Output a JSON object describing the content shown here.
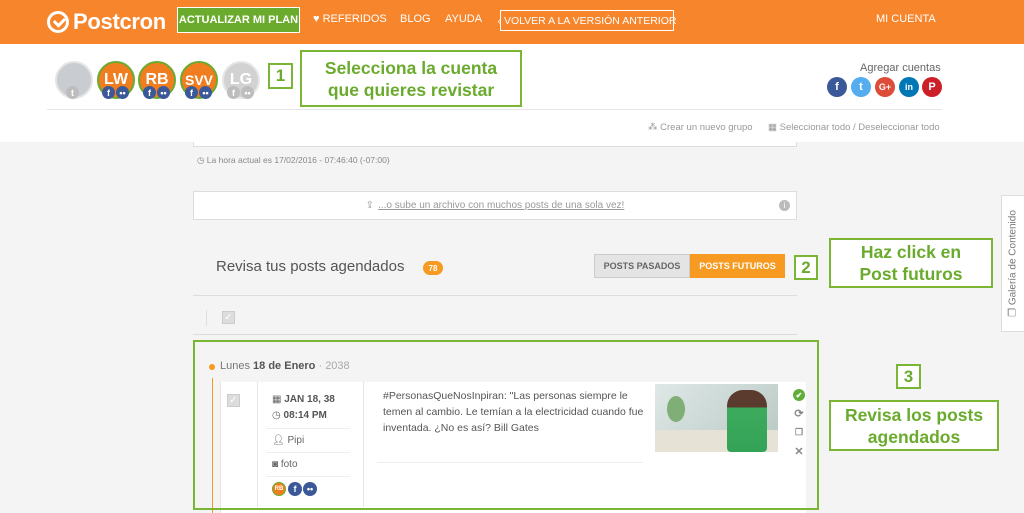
{
  "topnav": {
    "logo": "Postcron",
    "plan_button": "ACTUALIZAR MI PLAN",
    "referidos": "♥ REFERIDOS",
    "blog": "BLOG",
    "ayuda": "AYUDA",
    "volver": "‹ VOLVER A LA VERSIÓN ANTERIOR",
    "mi_cuenta": "MI CUENTA"
  },
  "accounts": {
    "items": [
      {
        "initials": "",
        "selected": false
      },
      {
        "initials": "LW",
        "selected": true
      },
      {
        "initials": "RB",
        "selected": true
      },
      {
        "initials": "SVV",
        "selected": true
      },
      {
        "initials": "LG",
        "selected": false
      }
    ],
    "agregar_label": "Agregar cuentas",
    "crear_grupo": "Crear un nuevo grupo",
    "seleccionar_todo": "Seleccionar todo / Deseleccionar todo"
  },
  "annotations": {
    "step1_num": "1",
    "step1_text_line1": "Selecciona la cuenta",
    "step1_text_line2": "que quieres revistar",
    "step2_num": "2",
    "step2_text_line1": "Haz click en",
    "step2_text_line2": "Post futuros",
    "step3_num": "3",
    "step3_text_line1": "Revisa los posts",
    "step3_text_line2": "agendados"
  },
  "main": {
    "hora_actual": "La hora actual es 17/02/2016 - 07:46:40 (-07:00)",
    "upload_text": "...o sube un archivo con muchos posts de una sola vez!",
    "section_title": "Revisa tus posts agendados",
    "count": "78",
    "tab_pasados": "POSTS PASADOS",
    "tab_futuros": "POSTS FUTUROS",
    "date_day": "Lunes",
    "date_bold": "18 de Enero",
    "date_year": "· 2038"
  },
  "post": {
    "date": "JAN 18, 38",
    "time": "08:14 PM",
    "author": "Pipi",
    "type": "foto",
    "account_initials": "RB",
    "text": "#PersonasQueNosInpiran: \"Las personas siempre le temen al cambio. Le temían a la electricidad cuando fue inventada. ¿No es así? Bill Gates"
  },
  "gallery_tab": "Galería de Contenido",
  "colors": {
    "brand_orange": "#f7852b",
    "accent_green": "#6aab2e",
    "badge_orange": "#f79a21"
  }
}
